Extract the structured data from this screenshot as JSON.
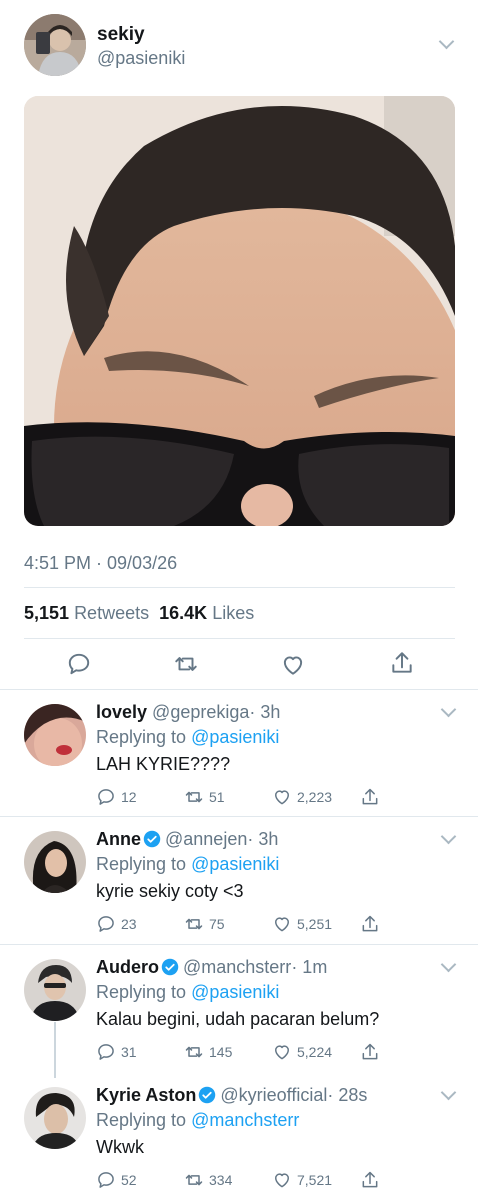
{
  "tweet": {
    "name": "sekiy",
    "handle": "@pasieniki",
    "timestamp": "4:51 PM · 09/03/26",
    "retweets_count": "5,151",
    "retweets_label": "Retweets",
    "likes_count": "16.4K",
    "likes_label": "Likes"
  },
  "icons": {
    "reply": "reply-icon",
    "retweet": "retweet-icon",
    "like": "heart-icon",
    "share": "share-icon",
    "verified": "verified-badge-icon",
    "caret": "chevron-down-icon"
  },
  "colors": {
    "link": "#1da1f2",
    "secondary_text": "#657786",
    "icon": "#657786",
    "divider": "#e1e8ed"
  },
  "replies": [
    {
      "name": "lovely",
      "handle": "@geprekiga",
      "time": "· 3h",
      "verified": false,
      "replying_label": "Replying to",
      "replying_to": "@pasieniki",
      "text": "LAH KYRIE????",
      "replies": "12",
      "retweets": "51",
      "likes": "2,223"
    },
    {
      "name": "Anne",
      "handle": "@annejen",
      "time": "· 3h",
      "verified": true,
      "replying_label": "Replying to",
      "replying_to": "@pasieniki",
      "text": "kyrie sekiy coty <3",
      "replies": "23",
      "retweets": "75",
      "likes": "5,251"
    },
    {
      "name": "Audero",
      "handle": "@manchsterr",
      "time": "· 1m",
      "verified": true,
      "replying_label": "Replying to",
      "replying_to": "@pasieniki",
      "text": "Kalau begini, udah pacaran belum?",
      "replies": "31",
      "retweets": "145",
      "likes": "5,224"
    },
    {
      "name": "Kyrie Aston",
      "handle": "@kyrieofficial",
      "time": "· 28s",
      "verified": true,
      "replying_label": "Replying to",
      "replying_to": "@manchsterr",
      "text": "Wkwk",
      "replies": "52",
      "retweets": "334",
      "likes": "7,521"
    }
  ]
}
